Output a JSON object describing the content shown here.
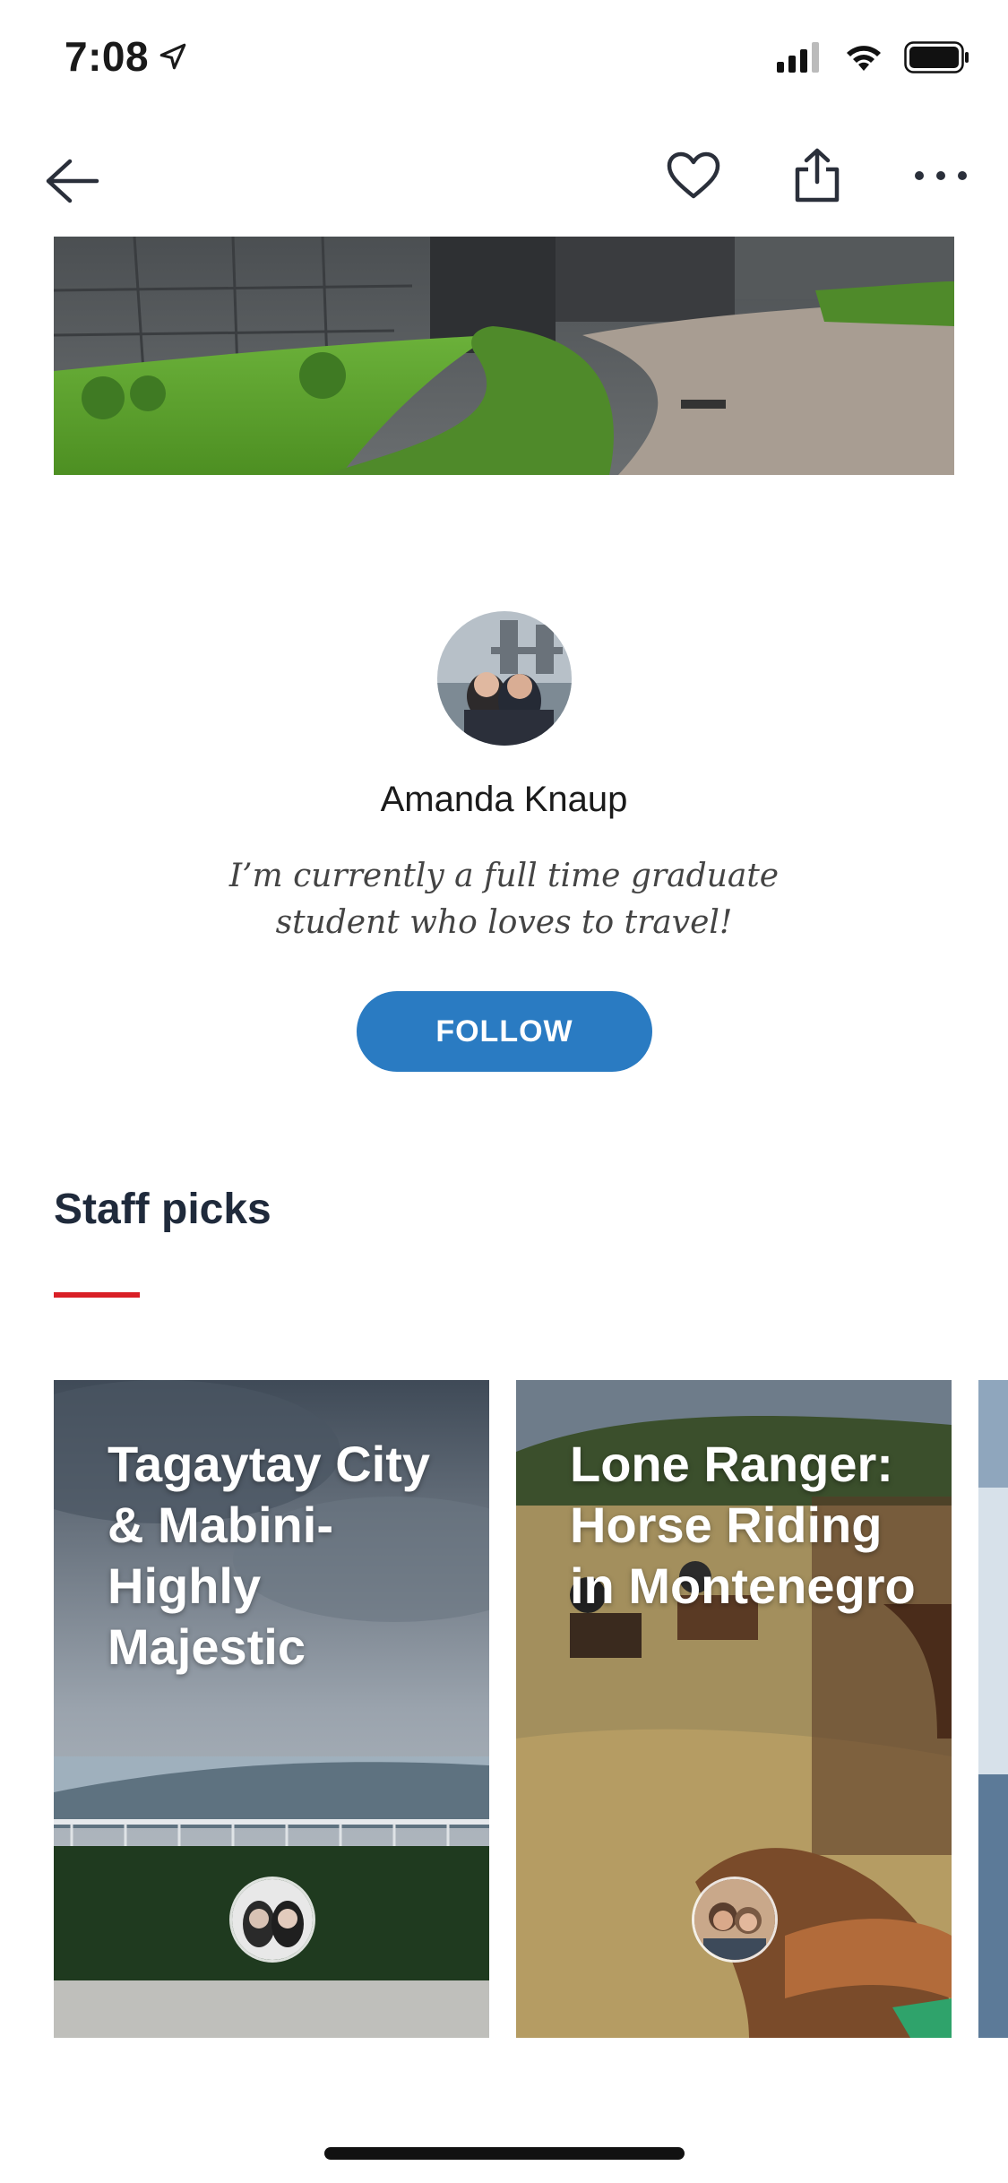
{
  "status_bar": {
    "time": "7:08"
  },
  "nav": {
    "icons": [
      "back-arrow-icon",
      "heart-icon",
      "share-icon",
      "more-icon"
    ]
  },
  "profile": {
    "name": "Amanda Knaup",
    "bio": "I’m currently a full time graduate student who loves to travel!",
    "follow_label": "FOLLOW"
  },
  "staff_picks": {
    "title": "Staff picks",
    "cards": [
      {
        "title": "Tagaytay City & Mabini-Highly Majestic"
      },
      {
        "title": "Lone Ranger: Horse Riding in Montenegro"
      }
    ]
  },
  "colors": {
    "accent_blue": "#2a7bc2",
    "underline_red": "#d91f26",
    "heading": "#1f2a3b"
  }
}
